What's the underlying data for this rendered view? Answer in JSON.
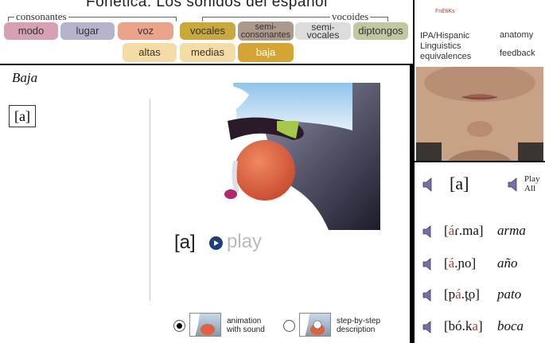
{
  "header": {
    "title": "Fonética:  Los sonidos del español",
    "groups": {
      "consonants": "consonantes",
      "vowels": "vocoides"
    },
    "tabs": {
      "modo": "modo",
      "lugar": "lugar",
      "voz": "voz",
      "vocales": "vocales",
      "semi_consonantes": "semi-consonantes",
      "semi_vocales": "semi-vocales",
      "diptongos": "diptongos",
      "altas": "altas",
      "medias": "medias",
      "baja": "baja"
    },
    "colors": {
      "modo": "#d7a0b4",
      "lugar": "#b4b4cc",
      "voz": "#eba48a",
      "vocales": "#c8a93a",
      "semi_consonantes": "#ad998c",
      "semi_vocales": "#dcdcdc",
      "diptongos": "#c0c8a2",
      "altas": "#f4dca6",
      "medias": "#f4dca6",
      "baja": "#d4a535"
    }
  },
  "left_panel": {
    "heading": "Baja",
    "sound_button": "[a]",
    "phone_label": "[a]",
    "play_label": "play",
    "options": {
      "animation": "animation with sound",
      "step_by_step": "step-by-step description"
    }
  },
  "right_panel": {
    "brand": "FnEtiKs",
    "links": {
      "ipa": "IPA/Hispanic Linguistics equivalences",
      "anatomy": "anatomy",
      "feedback": "feedback"
    },
    "phone": "[a]",
    "play_all": "Play All",
    "examples": [
      {
        "pre": "[",
        "hl": "á",
        "post": "ɾ.ma]",
        "word": "arma"
      },
      {
        "pre": "[",
        "hl": "á",
        "post": ".ɲo]",
        "word": "año"
      },
      {
        "pre": "[p",
        "hl": "á",
        "post": ".t̪o]",
        "word": "pato"
      },
      {
        "pre": "[bó.k",
        "hl": "a",
        "post": "]",
        "word": "boca"
      }
    ]
  }
}
